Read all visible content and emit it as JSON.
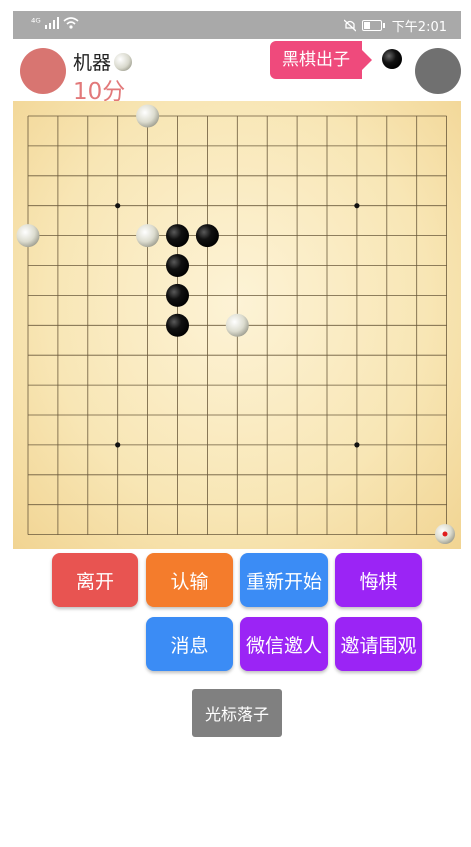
{
  "status_bar": {
    "signal": "⁴ᴳ",
    "time": "下午2:01"
  },
  "players": {
    "left": {
      "name": "机器",
      "score": "10分"
    }
  },
  "turn": {
    "label": "黑棋出子"
  },
  "board": {
    "size": 15,
    "star_points": [
      [
        3,
        3
      ],
      [
        11,
        3
      ],
      [
        3,
        11
      ],
      [
        11,
        11
      ]
    ],
    "black_stones": [
      [
        5,
        4
      ],
      [
        6,
        4
      ],
      [
        5,
        5
      ],
      [
        5,
        6
      ],
      [
        5,
        7
      ]
    ],
    "white_stones": [
      [
        4,
        0
      ],
      [
        0,
        4
      ],
      [
        4,
        4
      ],
      [
        7,
        7
      ]
    ],
    "corner_marker": "red-dot"
  },
  "buttons": {
    "leave": "离开",
    "resign": "认输",
    "restart": "重新开始",
    "undo": "悔棋",
    "message": "消息",
    "wechat_invite": "微信邀人",
    "invite_watch": "邀请围观",
    "cursor_place": "光标落子"
  },
  "colors": {
    "leave": "#e85451",
    "resign": "#f47c2c",
    "restart": "#3b8cf5",
    "undo": "#9b24f5",
    "message": "#3b8cf5",
    "wechat_invite": "#9b24f5",
    "invite_watch": "#9b24f5"
  }
}
